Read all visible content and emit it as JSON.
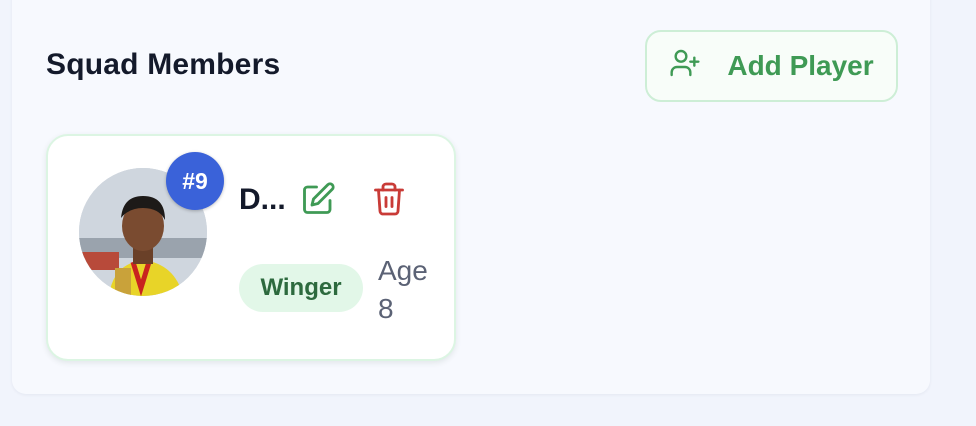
{
  "section": {
    "title": "Squad Members",
    "add_button_label": "Add Player"
  },
  "players": [
    {
      "jersey": "#9",
      "name": "D...",
      "position": "Winger",
      "age_label": "Age",
      "age_value": "8"
    }
  ],
  "colors": {
    "accent_green": "#3f9a55",
    "badge_blue": "#3a62d9",
    "delete_red": "#c93b37"
  },
  "icons": [
    "user-plus-icon",
    "edit-icon",
    "trash-icon"
  ]
}
